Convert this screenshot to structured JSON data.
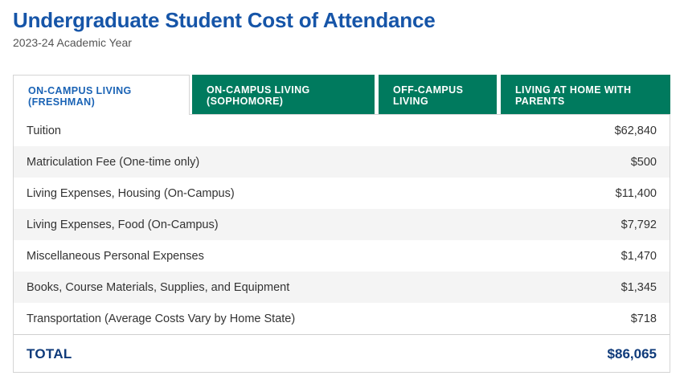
{
  "header": {
    "title": "Undergraduate Student Cost of Attendance",
    "subtitle": "2023-24 Academic Year"
  },
  "tabs": [
    {
      "label": "ON-CAMPUS LIVING (FRESHMAN)",
      "active": true
    },
    {
      "label": "ON-CAMPUS LIVING (SOPHOMORE)",
      "active": false
    },
    {
      "label": "OFF-CAMPUS LIVING",
      "active": false
    },
    {
      "label": "LIVING AT HOME WITH PARENTS",
      "active": false
    }
  ],
  "table": {
    "rows": [
      {
        "label": "Tuition",
        "amount": "$62,840"
      },
      {
        "label": "Matriculation Fee (One-time only)",
        "amount": "$500"
      },
      {
        "label": "Living Expenses, Housing (On-Campus)",
        "amount": "$11,400"
      },
      {
        "label": "Living Expenses, Food (On-Campus)",
        "amount": "$7,792"
      },
      {
        "label": "Miscellaneous Personal Expenses",
        "amount": "$1,470"
      },
      {
        "label": "Books, Course Materials, Supplies, and Equipment",
        "amount": "$1,345"
      },
      {
        "label": "Transportation (Average Costs Vary by Home State)",
        "amount": "$718"
      }
    ],
    "total": {
      "label": "TOTAL",
      "amount": "$86,065"
    }
  },
  "colors": {
    "title": "#1655a8",
    "tab_active_text": "#1a63b5",
    "tab_inactive_bg": "#007a5e",
    "total_text": "#0e3a7a"
  }
}
